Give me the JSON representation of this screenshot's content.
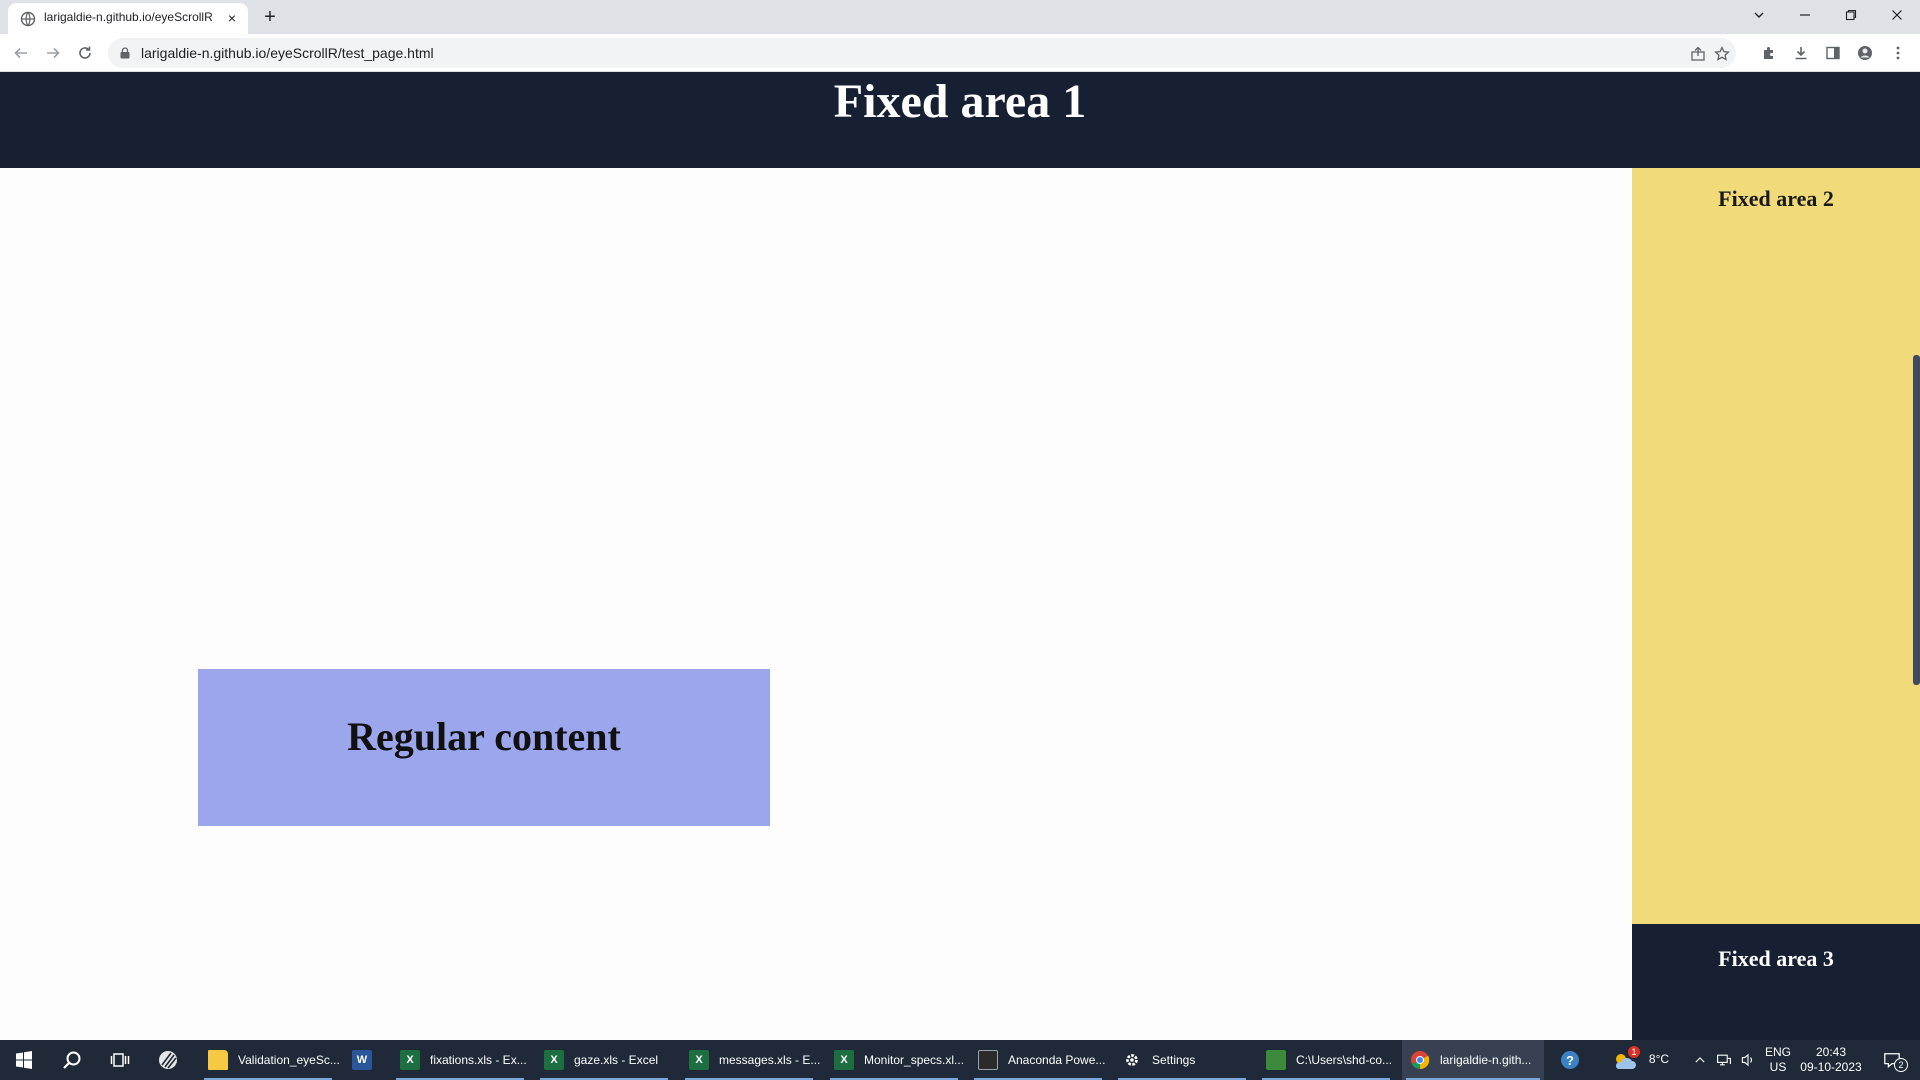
{
  "browser": {
    "tab_title": "larigaldie-n.github.io/eyeScrollR",
    "new_tab_label": "+",
    "close_tab_label": "×",
    "url": "larigaldie-n.github.io/eyeScrollR/test_page.html"
  },
  "page": {
    "fixed_area_1": "Fixed area 1",
    "fixed_area_2": "Fixed area 2",
    "fixed_area_3": "Fixed area 3",
    "regular_content": "Regular content"
  },
  "taskbar": {
    "apps": [
      {
        "label": "Validation_eyeSc...",
        "icon": "folder-icon",
        "color": "#f6c945"
      },
      {
        "label": "",
        "icon": "word-icon",
        "color": "#2b579a"
      },
      {
        "label": "fixations.xls - Ex...",
        "icon": "excel-icon",
        "color": "#1d6f42"
      },
      {
        "label": "gaze.xls - Excel",
        "icon": "excel-icon",
        "color": "#1d6f42"
      },
      {
        "label": "messages.xls - E...",
        "icon": "excel-icon",
        "color": "#1d6f42"
      },
      {
        "label": "Monitor_specs.xl...",
        "icon": "excel-icon",
        "color": "#1d6f42"
      },
      {
        "label": "Anaconda Powe...",
        "icon": "terminal-icon",
        "color": "#2b2b2b"
      },
      {
        "label": "Settings",
        "icon": "gear-icon",
        "color": "#1f2937"
      },
      {
        "label": "C:\\Users\\shd-co...",
        "icon": "notepad-icon",
        "color": "#3c8a3c"
      },
      {
        "label": "larigaldie-n.gith...",
        "icon": "chrome-icon",
        "color": "#4285f4"
      }
    ],
    "weather": "8°C",
    "weather_badge": "1",
    "lang_line1": "ENG",
    "lang_line2": "US",
    "time": "20:43",
    "date": "09-10-2023",
    "notification_count": "2"
  }
}
